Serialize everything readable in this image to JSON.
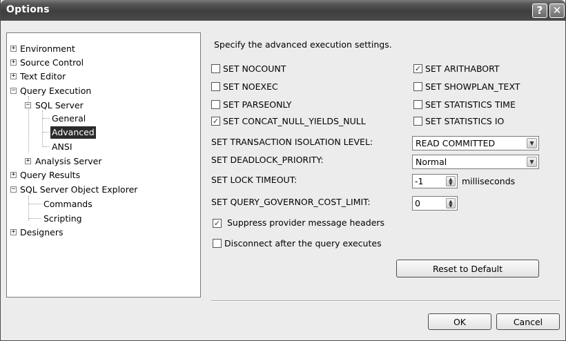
{
  "window": {
    "title": "Options"
  },
  "titlebar": {
    "help_glyph": "?",
    "close_glyph": "✕"
  },
  "tree": {
    "items": [
      {
        "label": "Environment",
        "expander": "+"
      },
      {
        "label": "Source Control",
        "expander": "+"
      },
      {
        "label": "Text Editor",
        "expander": "+"
      },
      {
        "label": "Query Execution",
        "expander": "−"
      },
      {
        "label": "SQL Server",
        "expander": "−"
      },
      {
        "label": "General"
      },
      {
        "label": "Advanced",
        "selected": true
      },
      {
        "label": "ANSI"
      },
      {
        "label": "Analysis Server",
        "expander": "+"
      },
      {
        "label": "Query Results",
        "expander": "+"
      },
      {
        "label": "SQL Server Object Explorer",
        "expander": "−"
      },
      {
        "label": "Commands"
      },
      {
        "label": "Scripting"
      },
      {
        "label": "Designers",
        "expander": "+"
      }
    ]
  },
  "panel": {
    "heading": "Specify the advanced execution settings.",
    "checkboxes_left": [
      {
        "label": "SET NOCOUNT",
        "checked": false
      },
      {
        "label": "SET NOEXEC",
        "checked": false
      },
      {
        "label": "SET PARSEONLY",
        "checked": false
      },
      {
        "label": "SET CONCAT_NULL_YIELDS_NULL",
        "checked": true
      }
    ],
    "checkboxes_right": [
      {
        "label": "SET ARITHABORT",
        "checked": true
      },
      {
        "label": "SET SHOWPLAN_TEXT",
        "checked": false
      },
      {
        "label": "SET STATISTICS TIME",
        "checked": false
      },
      {
        "label": "SET STATISTICS IO",
        "checked": false
      }
    ],
    "isolation_label": "SET TRANSACTION ISOLATION LEVEL:",
    "isolation_value": "READ COMMITTED",
    "deadlock_label": "SET DEADLOCK_PRIORITY:",
    "deadlock_value": "Normal",
    "lock_timeout_label": "SET LOCK TIMEOUT:",
    "lock_timeout_value": "-1",
    "lock_timeout_unit": "milliseconds",
    "governor_label": "SET QUERY_GOVERNOR_COST_LIMIT:",
    "governor_value": "0",
    "suppress_label": "Suppress provider message headers",
    "suppress_checked": true,
    "disconnect_label": "Disconnect after the query executes",
    "disconnect_checked": false,
    "reset_label": "Reset to Default"
  },
  "footer": {
    "ok_label": "OK",
    "cancel_label": "Cancel"
  },
  "glyphs": {
    "check": "✓",
    "combo_arrow": "▼",
    "spin_up": "▲",
    "spin_down": "▼"
  }
}
